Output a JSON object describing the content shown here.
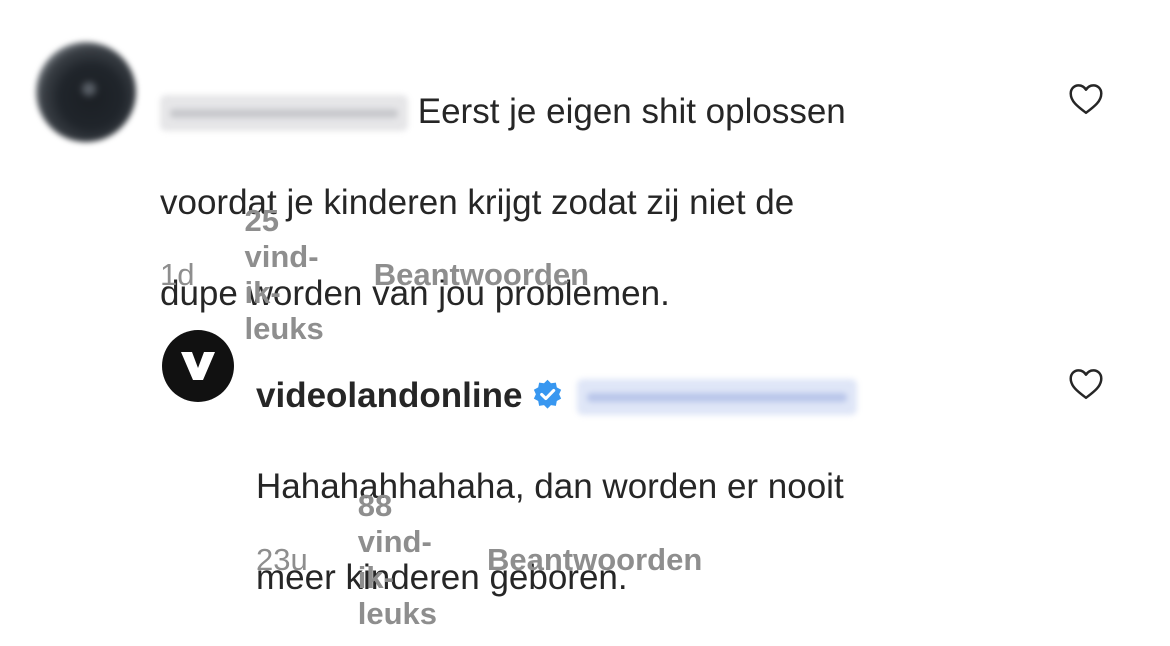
{
  "comments": [
    {
      "username": "",
      "username_redacted": true,
      "text_lines": [
        "Eerst je eigen shit oplossen",
        "voordat je kinderen krijgt zodat zij niet de",
        "dupe worden van jou problemen."
      ],
      "time": "1d",
      "likes": "25 vind-ik-leuks",
      "reply_label": "Beantwoorden",
      "avatar_icon": "blurred-profile-avatar",
      "like_icon": "heart-outline-icon"
    },
    {
      "username": "videolandonline",
      "verified": true,
      "mention_redacted": true,
      "text_lines": [
        "Hahahahhahaha, dan worden er nooit",
        "meer kinderen geboren."
      ],
      "time": "23u",
      "likes": "88 vind-ik-leuks",
      "reply_label": "Beantwoorden",
      "avatar_icon": "videoland-v-logo",
      "like_icon": "heart-outline-icon"
    }
  ],
  "colors": {
    "text": "#262626",
    "meta": "#8e8e8e",
    "verified_blue": "#3897f0",
    "avatar_dark": "#111111"
  }
}
